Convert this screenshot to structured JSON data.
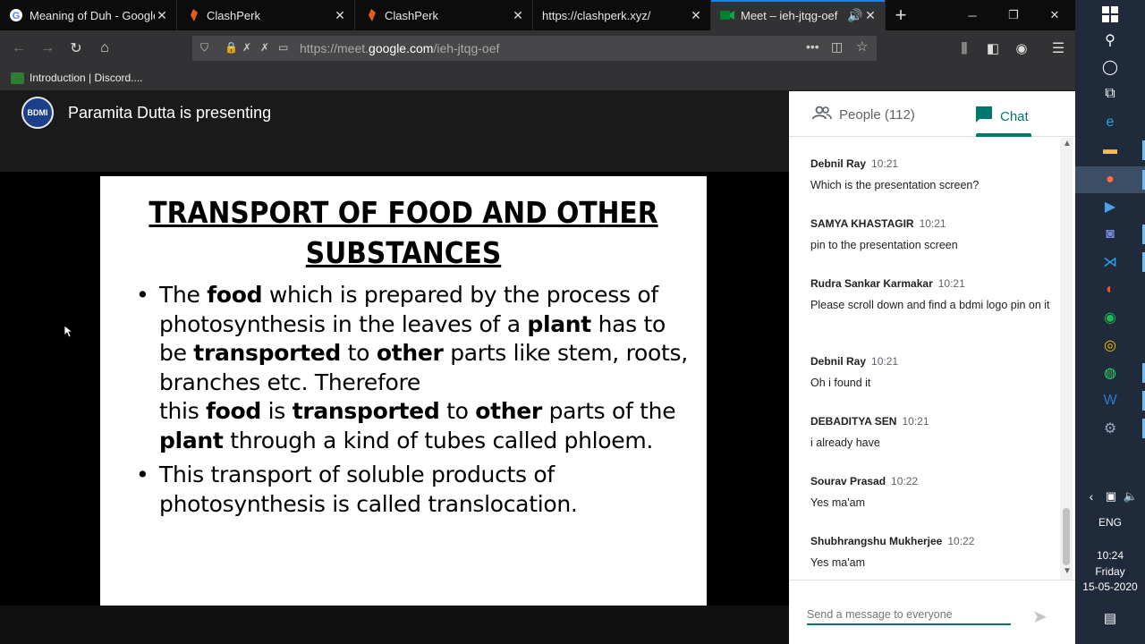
{
  "browser": {
    "tabs": [
      {
        "title": "Meaning of Duh - Google",
        "icon": "google-g-icon",
        "active": false
      },
      {
        "title": "ClashPerk",
        "icon": "clashperk-icon",
        "active": false
      },
      {
        "title": "ClashPerk",
        "icon": "clashperk-icon",
        "active": false
      },
      {
        "title": "https://clashperk.xyz/",
        "icon": "",
        "active": false
      },
      {
        "title": "Meet – ieh-jtqg-oef",
        "icon": "meet-icon",
        "active": true
      }
    ],
    "url_prefix": "https://meet.",
    "url_domain": "google.com",
    "url_path": "/ieh-jtqg-oef",
    "bookmark": "Introduction | Discord...."
  },
  "meet": {
    "presenting": "Paramita Dutta is presenting",
    "logo_text": "BDMI"
  },
  "slide": {
    "title_line1": "TRANSPORT OF FOOD AND OTHER",
    "title_line2": "SUBSTANCES",
    "b1_p1": "The ",
    "b1_food": "food",
    "b1_p2": " which is prepared by the process of photosynthesis in the leaves of a ",
    "b1_plant": "plant",
    "b1_p3": " has to be ",
    "b1_transported": "transported",
    "b1_p4": " to ",
    "b1_other": "other",
    "b1_p5": " parts like stem, roots, branches etc. Therefore",
    "b1_p6": "this ",
    "b1_food2": "food",
    "b1_p7": " is ",
    "b1_transported2": "transported",
    "b1_p8": " to ",
    "b1_other2": "other",
    "b1_p9": " parts of the ",
    "b1_plant2": "plant",
    "b1_p10": " through a kind of tubes called phloem.",
    "bullet2": "This transport of soluble products of photosynthesis is called translocation."
  },
  "panel": {
    "people_label": "People (112)",
    "chat_label": "Chat",
    "messages": [
      {
        "name": "Debnil Ray",
        "time": "10:21",
        "text": "Which is the presentation screen?"
      },
      {
        "name": "SAMYA KHASTAGIR",
        "time": "10:21",
        "text": "pin to the presentation screen"
      },
      {
        "name": "Rudra Sankar Karmakar",
        "time": "10:21",
        "text": "Please scroll down and find a bdmi logo pin on it"
      },
      {
        "name": "Debnil Ray",
        "time": "10:21",
        "text": "Oh i found it"
      },
      {
        "name": "DEBADITYA SEN",
        "time": "10:21",
        "text": "i already have"
      },
      {
        "name": "Sourav Prasad",
        "time": "10:22",
        "text": "Yes ma'am"
      },
      {
        "name": "Shubhrangshu Mukherjee",
        "time": "10:22",
        "text": "Yes ma'am"
      }
    ],
    "placeholder": "Send a message to everyone"
  },
  "taskbar": {
    "lang": "ENG",
    "time": "10:24",
    "day": "Friday",
    "date": "15-05-2020"
  },
  "colors": {
    "meet_accent": "#00796b",
    "firefox_blue": "#0a84ff"
  }
}
